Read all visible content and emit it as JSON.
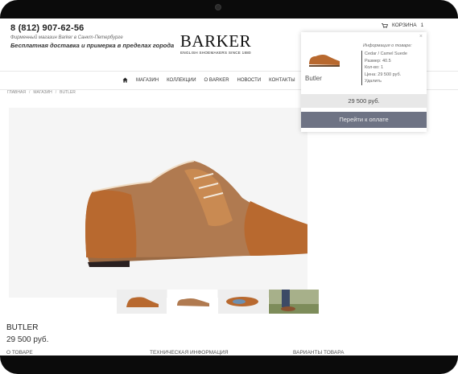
{
  "header": {
    "phone": "8 (812) 907-62-56",
    "store_line": "Фирменный магазин Barker в Санкт-Петербурге",
    "delivery": "Бесплатная доставка и примерка в пределах города",
    "logo_main": "BARKER",
    "logo_sub": "ENGLISH SHOEMAKERS SINCE 1880",
    "cart_label": "КОРЗИНА",
    "cart_count": "1"
  },
  "nav": {
    "items": [
      "МАГАЗИН",
      "КОЛЛЕКЦИИ",
      "О BARKER",
      "НОВОСТИ",
      "КОНТАКТЫ"
    ]
  },
  "breadcrumb": [
    "ГЛАВНАЯ",
    "МАГАЗИН",
    "BUTLER"
  ],
  "product": {
    "name": "BUTLER",
    "price": "29 500 руб.",
    "tabs": [
      "О ТОВАРЕ",
      "ТЕХНИЧЕСКАЯ ИНФОРМАЦИЯ",
      "ВАРИАНТЫ ТОВАРА"
    ]
  },
  "cart_popup": {
    "item_title": "Butler",
    "info_heading": "Информация о товаре:",
    "info_lines": [
      "Cedar / Camel Suede",
      "Размер: 40.5",
      "Кол-во: 1",
      "Цена: 29 500 руб."
    ],
    "remove_label": "Удалить",
    "total": "29 500 руб.",
    "checkout_label": "Перейти к оплате"
  },
  "colors": {
    "checkout_button": "#6e7384",
    "total_bar": "#e8e8e8",
    "shoe_leather": "#b8692f",
    "shoe_suede": "#b07a50"
  }
}
